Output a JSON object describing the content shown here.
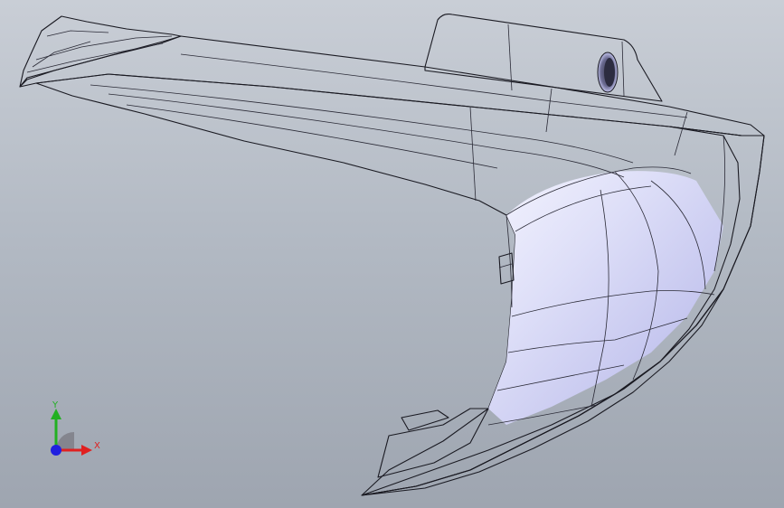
{
  "viewport": {
    "background_top": "#c9ced6",
    "background_bottom": "#9ea5b0",
    "model_color": "#c8c9f2"
  },
  "triad": {
    "x_label": "X",
    "y_label": "Y",
    "x_color": "#e02020",
    "y_color": "#22b022",
    "z_color": "#2020e0"
  }
}
